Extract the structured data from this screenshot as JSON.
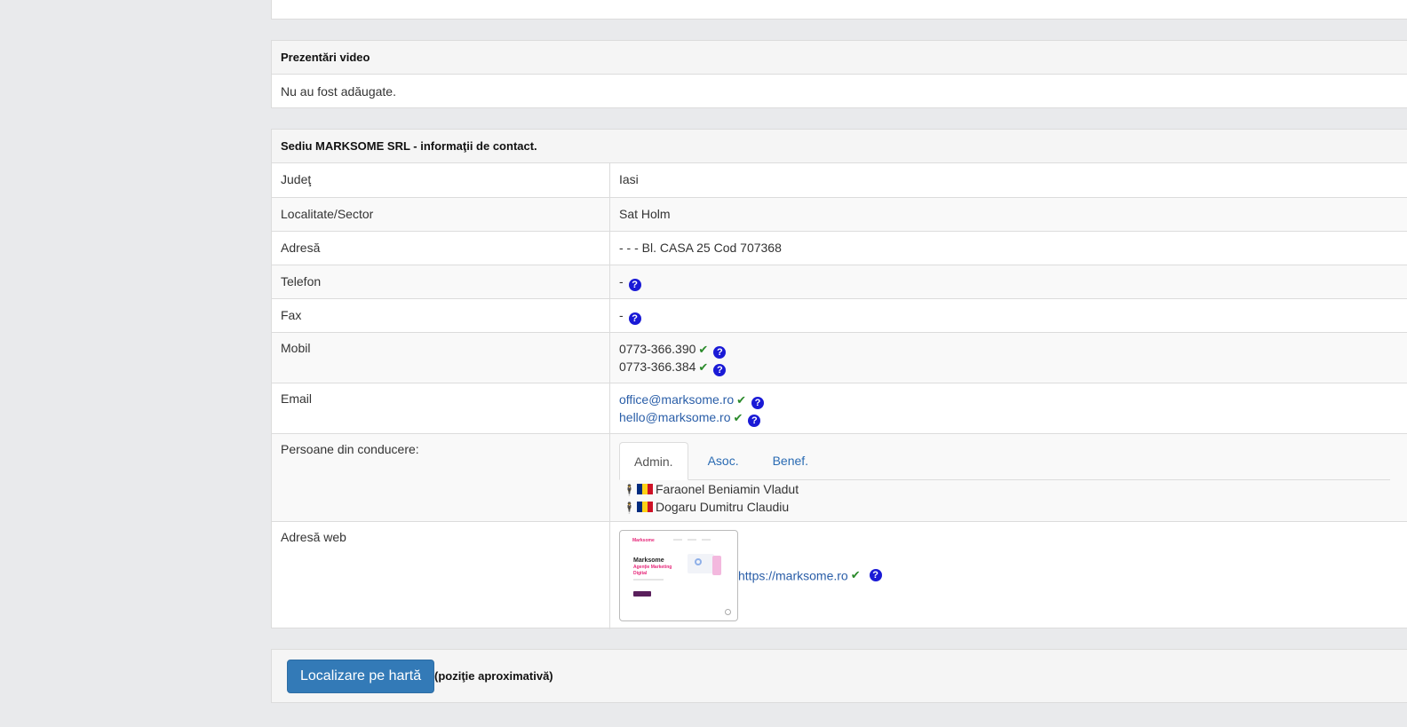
{
  "video": {
    "title": "Prezentări video",
    "empty_text": "Nu au fost adăugate."
  },
  "contact": {
    "title": "Sediu MARKSOME SRL - informaţii de contact.",
    "rows": {
      "judet": {
        "label": "Judeţ",
        "value": "Iasi"
      },
      "localitate": {
        "label": "Localitate/Sector",
        "value": "Sat Holm"
      },
      "adresa": {
        "label": "Adresă",
        "value": "- - - Bl. CASA 25 Cod 707368"
      },
      "telefon": {
        "label": "Telefon",
        "value": "-"
      },
      "fax": {
        "label": "Fax",
        "value": "-"
      },
      "mobil": {
        "label": "Mobil",
        "values": [
          "0773-366.390",
          "0773-366.384"
        ]
      },
      "email": {
        "label": "Email",
        "values": [
          "office@marksome.ro",
          "hello@marksome.ro"
        ]
      },
      "persoane": {
        "label": "Persoane din conducere:",
        "tabs": [
          "Admin.",
          "Asoc.",
          "Benef."
        ],
        "active_tab": "Admin.",
        "people": [
          "Faraonel Beniamin Vladut",
          "Dogaru Dumitru Claudiu"
        ]
      },
      "web": {
        "label": "Adresă web",
        "value": "https://marksome.ro"
      }
    },
    "icons": {
      "verified": "check-icon",
      "help": "question-circle-icon",
      "person": "person-icon",
      "flag": "romania-flag-icon"
    },
    "flag_colors": [
      "#002b7f",
      "#fcd116",
      "#ce1126"
    ]
  },
  "map": {
    "button_label": "Localizare pe hartă",
    "note": "(poziţie aproximativă)"
  },
  "thumbnail": {
    "brand": "Marksome",
    "headline1": "Marksome",
    "headline2": "Agenție Marketing",
    "headline3": "Digital",
    "accent": "#e6287a"
  }
}
